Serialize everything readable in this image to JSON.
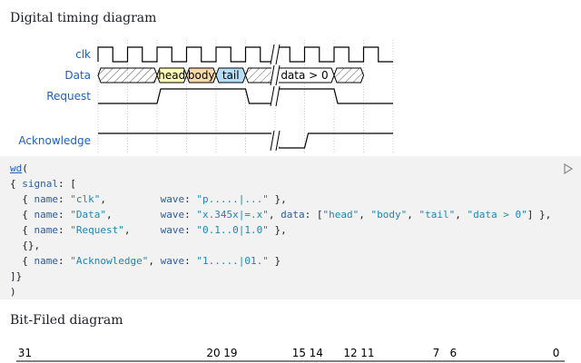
{
  "page": {
    "timing_title": "Digital timing diagram",
    "bitfield_title": "Bit-Filed diagram"
  },
  "timing": {
    "signals": [
      {
        "name": "clk",
        "wave": "p.....|..."
      },
      {
        "name": "Data",
        "wave": "x.345x|=.x",
        "data": [
          "head",
          "body",
          "tail",
          "data > 0"
        ]
      },
      {
        "name": "Request",
        "wave": "0.1..0|1.0"
      },
      {
        "name": "Acknowledge",
        "wave": "1.....|01."
      }
    ],
    "colors": {
      "head": "#fdfbb5",
      "body": "#f9d9a9",
      "tail": "#b5dff8",
      "data": "#ffffff",
      "label": "#1f5fbf",
      "grid": "#cccccc"
    }
  },
  "code": {
    "fn": "wd",
    "lines": [
      "{ signal: [",
      "  { name: \"clk\",         wave: \"p.....|...\" },",
      "  { name: \"Data\",        wave: \"x.345x|=.x\", data: [\"head\", \"body\", \"tail\", \"data > 0\"] },",
      "  { name: \"Request\",     wave: \"0.1..0|1.0\" },",
      "  {},",
      "  { name: \"Acknowledge\", wave: \"1.....|01.\" }",
      "]}",
      ")"
    ],
    "run_icon": "play-icon"
  },
  "bitfield": {
    "bit_labels": [
      "31",
      "20",
      "19",
      "15",
      "14",
      "12",
      "11",
      "7",
      "6",
      "0"
    ]
  }
}
